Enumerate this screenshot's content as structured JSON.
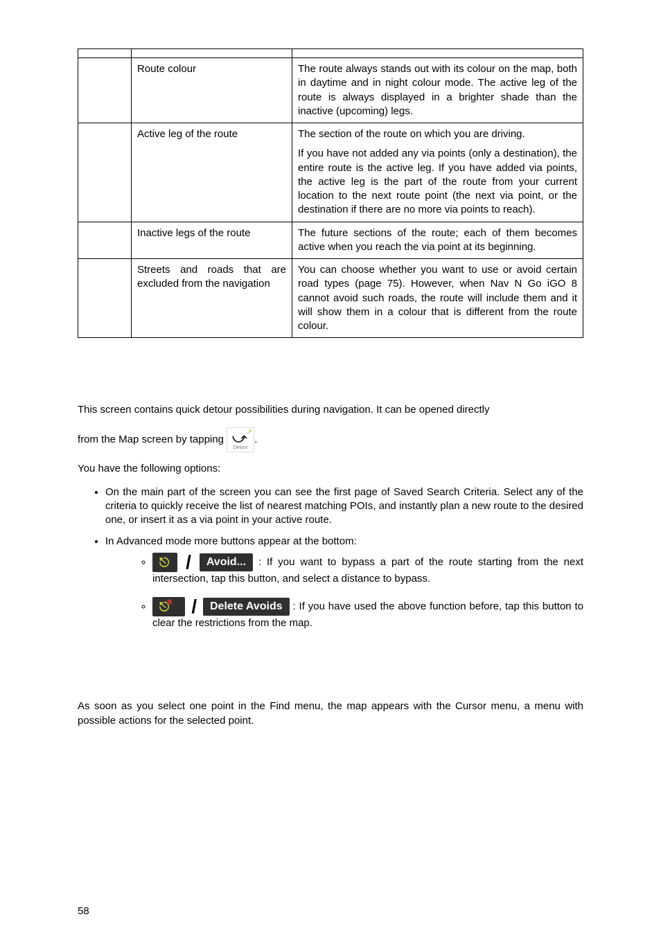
{
  "table": {
    "rows": [
      {
        "c1": "",
        "c2": "",
        "c3": ""
      },
      {
        "c1": "",
        "c2": "Route colour",
        "c3": "The route always stands out with its colour on the map, both in daytime and in night colour mode. The active leg of the route is always displayed in a brighter shade than the inactive (upcoming) legs."
      },
      {
        "c1": "",
        "c2": "Active leg of the route",
        "c3_intro": "The section of the route on which you are driving.",
        "c3_body": "If you have not added any via points (only a destination), the entire route is the active leg. If you have added via points, the active leg is the part of the route from your current location to the next route point (the next via point, or the destination if there are no more via points to reach)."
      },
      {
        "c1": "",
        "c2": "Inactive legs of the route",
        "c3": "The future sections of the route; each of them becomes active when you reach the via point at its beginning."
      },
      {
        "c1": "",
        "c2": "Streets and roads that are excluded from the navigation",
        "c3": "You can choose whether you want to use or avoid certain road types (page 75). However, when Nav N Go iGO 8 cannot avoid such roads, the route will include them and it will show them in a colour that is different from the route colour."
      }
    ]
  },
  "body": {
    "p1": "This screen contains quick detour possibilities during navigation. It can be opened directly",
    "p1_tail_a": "from the Map screen by tapping ",
    "p1_tail_b": ".",
    "detour_label": "Detour",
    "p2": "You have the following options:",
    "b1": "On the main part of the screen you can see the first page of Saved Search Criteria. Select any of the criteria to quickly receive the list of nearest matching POIs, and instantly plan a new route to the desired one, or insert it as a via point in your active route.",
    "b2": "In Advanced mode more buttons appear at the bottom:",
    "avoid_label": "Avoid...",
    "sb1": ": If you want to bypass a part of the route starting from the next intersection, tap this button, and select a distance to bypass.",
    "delete_label": "Delete Avoids",
    "sb2": ": If you have used the above function before, tap this button to clear the restrictions from the map.",
    "p3": "As soon as you select one point in the Find menu, the map appears with the Cursor menu, a menu with possible actions for the selected point."
  },
  "footer": {
    "page": "58"
  }
}
